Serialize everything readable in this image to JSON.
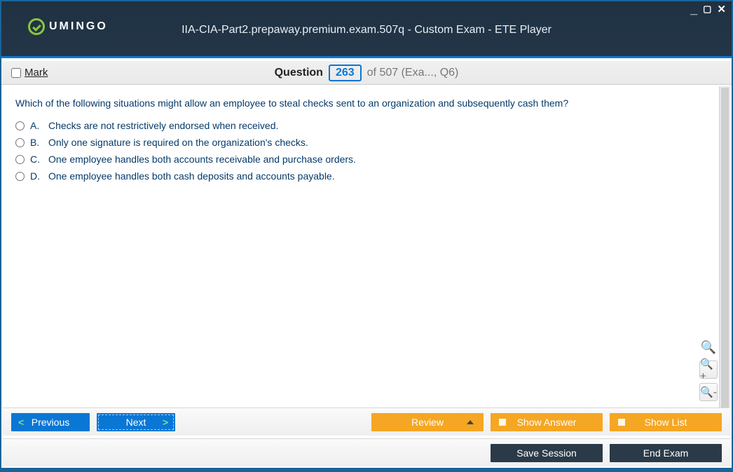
{
  "window": {
    "title": "IIA-CIA-Part2.prepaway.premium.exam.507q - Custom Exam - ETE Player",
    "logo_text": "UMINGO"
  },
  "toolbar": {
    "mark_label": "Mark",
    "question_word": "Question",
    "question_number": "263",
    "question_rest": "of 507 (Exa..., Q6)"
  },
  "question": {
    "stem": "Which of the following situations might allow an employee to steal checks sent to an organization and subsequently cash them?",
    "options": [
      {
        "letter": "A.",
        "text": "Checks are not restrictively endorsed when received."
      },
      {
        "letter": "B.",
        "text": "Only one signature is required on the organization's checks."
      },
      {
        "letter": "C.",
        "text": "One employee handles both accounts receivable and purchase orders."
      },
      {
        "letter": "D.",
        "text": "One employee handles both cash deposits and accounts payable."
      }
    ]
  },
  "buttons": {
    "previous": "Previous",
    "next": "Next",
    "review": "Review",
    "show_answer": "Show Answer",
    "show_list": "Show List",
    "save_session": "Save Session",
    "end_exam": "End Exam"
  }
}
